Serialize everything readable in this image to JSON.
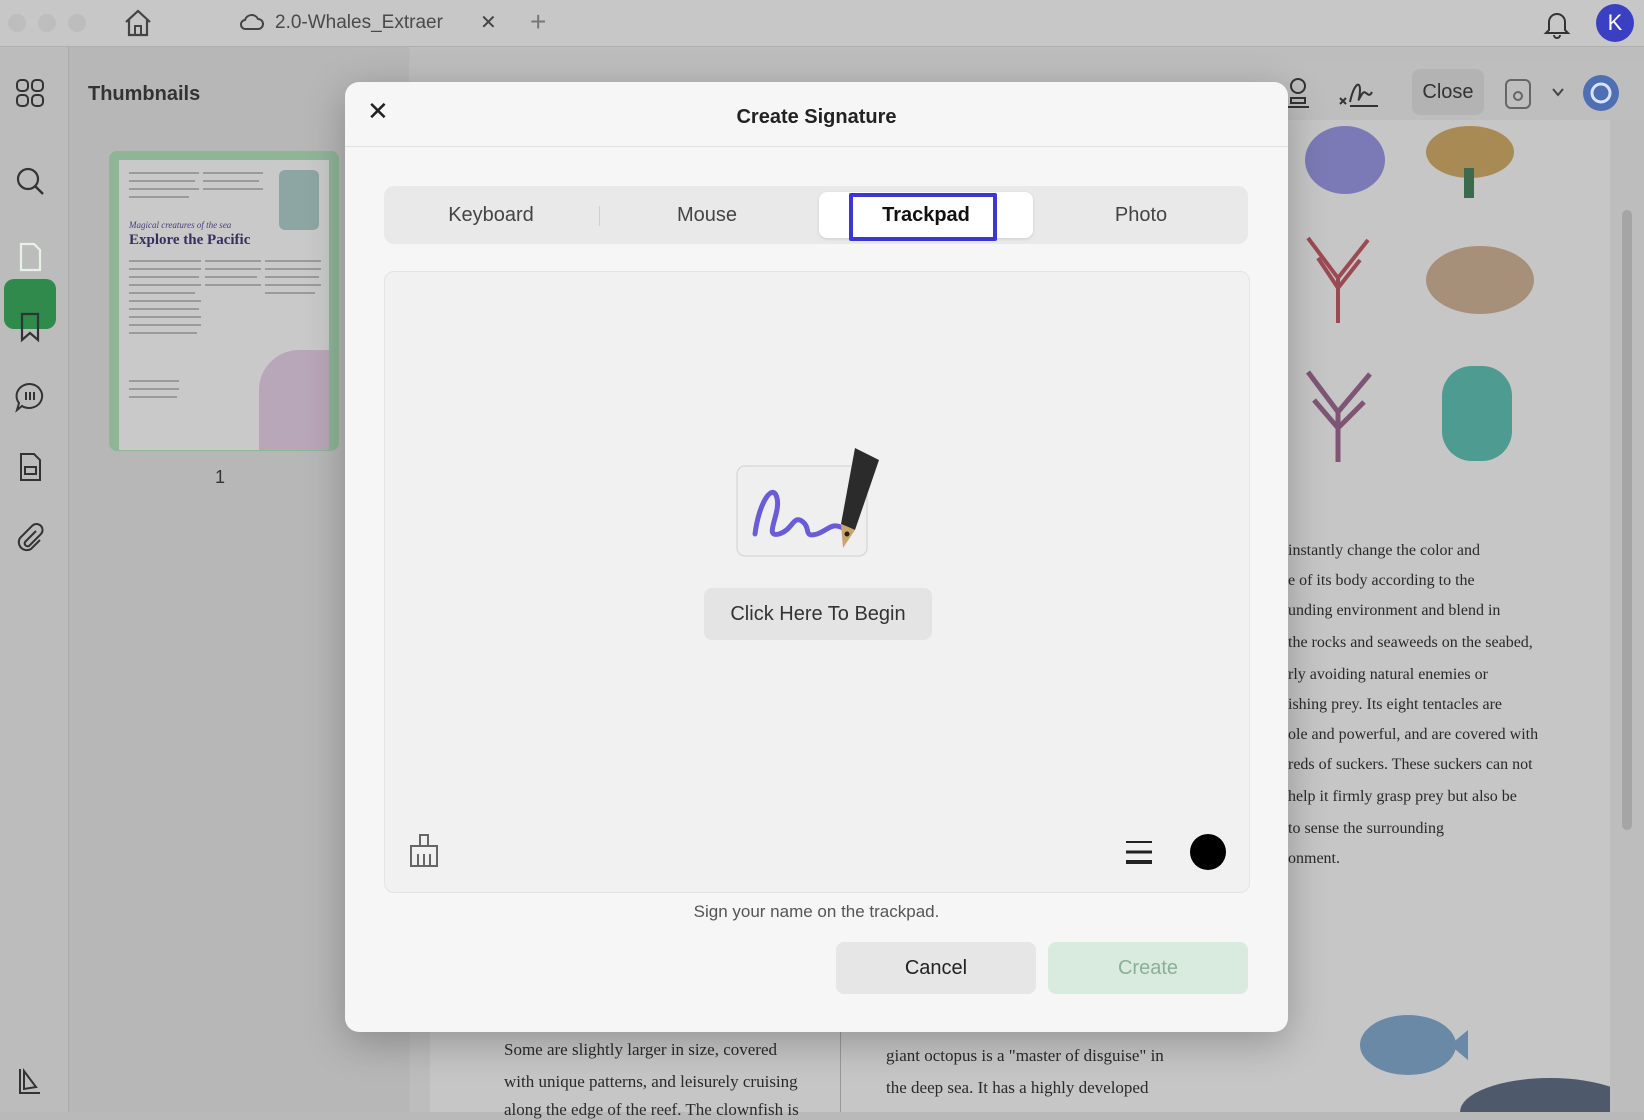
{
  "window": {
    "tab_title": "2.0-Whales_Extraer",
    "tab_close_glyph": "✕",
    "tab_add_glyph": "+",
    "avatar_initial": "K"
  },
  "sidebar": {
    "icons": [
      "grid-icon",
      "search-icon",
      "pages-icon",
      "bookmark-icon",
      "comment-icon",
      "form-icon",
      "attachment-icon",
      "layers-icon"
    ],
    "active": "pages-icon"
  },
  "thumbnails": {
    "heading": "Thumbnails",
    "page_number": "1",
    "page_subtitle": "Magical creatures of the sea",
    "page_title": "Explore the Pacific"
  },
  "toolbar": {
    "close_label": "Close"
  },
  "document": {
    "right_column_lines": [
      "instantly change the color and",
      "e of its body according to the",
      "unding environment and blend in",
      "the rocks and seaweeds on the seabed,",
      "rly avoiding natural enemies or",
      "ishing prey. Its eight tentacles are",
      "ole and powerful, and are covered with",
      "reds of suckers. These suckers can not",
      "help it firmly grasp prey but also be",
      "to sense the surrounding",
      "onment."
    ],
    "bottom_left_lines": [
      "Some are slightly larger in size, covered",
      "with unique patterns, and leisurely cruising",
      "along the edge of the reef. The clownfish is"
    ],
    "bottom_right_lines": [
      "giant octopus is a \"master of disguise\" in",
      "the deep sea. It has a highly developed"
    ]
  },
  "dialog": {
    "title": "Create Signature",
    "close_glyph": "✕",
    "tabs": [
      "Keyboard",
      "Mouse",
      "Trackpad",
      "Photo"
    ],
    "active_tab": "Trackpad",
    "begin_label": "Click Here To Begin",
    "hint": "Sign your name on the trackpad.",
    "cancel_label": "Cancel",
    "create_label": "Create",
    "pen_color": "#000000",
    "accent_color": "#3a37d6"
  }
}
